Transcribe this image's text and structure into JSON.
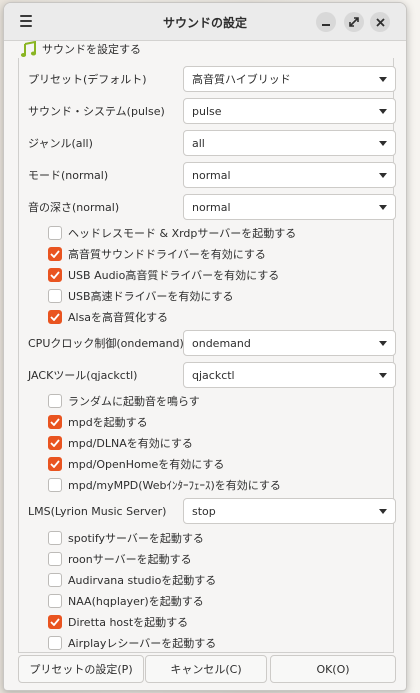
{
  "window": {
    "title": "サウンドの設定"
  },
  "header": {
    "label": "サウンドを設定する"
  },
  "combos": [
    {
      "label": "プリセット(デフォルト)",
      "value": "高音質ハイブリッド"
    },
    {
      "label": "サウンド・システム(pulse)",
      "value": "pulse"
    },
    {
      "label": "ジャンル(all)",
      "value": "all"
    },
    {
      "label": "モード(normal)",
      "value": "normal"
    },
    {
      "label": "音の深さ(normal)",
      "value": "normal"
    }
  ],
  "checks1": [
    {
      "label": "ヘッドレスモード & Xrdpサーバーを起動する",
      "checked": false
    },
    {
      "label": "高音質サウンドドライバーを有効にする",
      "checked": true
    },
    {
      "label": "USB Audio高音質ドライバーを有効にする",
      "checked": true
    },
    {
      "label": "USB高速ドライバーを有効にする",
      "checked": false
    },
    {
      "label": "Alsaを高音質化する",
      "checked": true
    }
  ],
  "combos2": [
    {
      "label": "CPUクロック制御(ondemand)",
      "value": "ondemand"
    },
    {
      "label": "JACKツール(qjackctl)",
      "value": "qjackctl"
    }
  ],
  "checks2": [
    {
      "label": "ランダムに起動音を鳴らす",
      "checked": false
    },
    {
      "label": "mpdを起動する",
      "checked": true
    },
    {
      "label": "mpd/DLNAを有効にする",
      "checked": true
    },
    {
      "label": "mpd/OpenHomeを有効にする",
      "checked": true
    },
    {
      "label": "mpd/myMPD(Webｲﾝﾀｰﾌｪｰｽ)を有効にする",
      "checked": false
    }
  ],
  "combos3": [
    {
      "label": "LMS(Lyrion Music Server)",
      "value": "stop"
    }
  ],
  "checks3": [
    {
      "label": "spotifyサーバーを起動する",
      "checked": false
    },
    {
      "label": "roonサーバーを起動する",
      "checked": false
    },
    {
      "label": "Audirvana studioを起動する",
      "checked": false
    },
    {
      "label": "NAA(hqplayer)を起動する",
      "checked": false
    },
    {
      "label": "Diretta hostを起動する",
      "checked": true
    },
    {
      "label": "Airplayレシーバーを起動する",
      "checked": false
    }
  ],
  "footer": {
    "preset_label": "プリセットの設定(P)",
    "cancel_label": "キャンセル(C)",
    "ok_label": "OK(O)"
  },
  "colors": {
    "accent": "#e95420",
    "icon_green": "#8ab523"
  }
}
